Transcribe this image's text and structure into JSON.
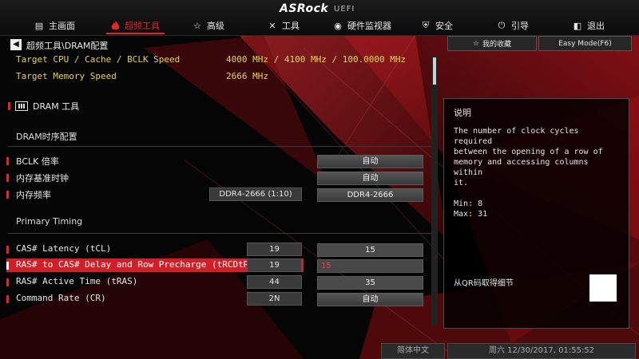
{
  "header": {
    "brand": "ASRock",
    "subtitle": "UEFI"
  },
  "tabs": [
    {
      "label": "主画面",
      "icon": "home-icon"
    },
    {
      "label": "超频工具",
      "icon": "flame-icon",
      "active": true
    },
    {
      "label": "高级",
      "icon": "star-icon"
    },
    {
      "label": "工具",
      "icon": "tools-icon"
    },
    {
      "label": "硬件监视器",
      "icon": "monitor-icon"
    },
    {
      "label": "安全",
      "icon": "shield-icon"
    },
    {
      "label": "引导",
      "icon": "power-icon"
    },
    {
      "label": "退出",
      "icon": "exit-icon"
    }
  ],
  "breadcrumb": "超频工具\\DRAM配置",
  "info": [
    {
      "label": "Target CPU / Cache / BCLK Speed",
      "value": "4000 MHz / 4100 MHz / 100.0000 MHz"
    },
    {
      "label": "Target Memory Speed",
      "value": "2666 MHz"
    }
  ],
  "dram_tool": "DRAM 工具",
  "section_dram": "DRAM时序配置",
  "section_primary": "Primary Timing",
  "rows": [
    {
      "label": "BCLK 倍率",
      "control": "自动"
    },
    {
      "label": "内存基准时钟",
      "control": "自动"
    },
    {
      "label": "内存频率",
      "current": "DDR4-2666 (1:10)",
      "control": "DDR4-2666"
    },
    {
      "label": "CAS# Latency (tCL)",
      "current": "19",
      "control": "15"
    },
    {
      "label": "RAS# to CAS# Delay and Row Precharge (tRCDtRP)",
      "current": "19",
      "control": "15"
    },
    {
      "label": "RAS# Active Time (tRAS)",
      "current": "44",
      "control": "35"
    },
    {
      "label": "Command Rate (CR)",
      "current": "2N",
      "control": "自动"
    }
  ],
  "right": {
    "favorites": "我的收藏",
    "easy_mode": "Easy Mode(F6)",
    "help_title": "说明",
    "help_text": "The number of clock cycles required\nbetween the opening of a row of\nmemory and accessing columns within\nit.\n\nMin: 8\nMax: 31",
    "qr_label": "从QR码取得细节"
  },
  "footer": {
    "language": "简体中文",
    "datetime": "周六 12/30/2017, 01:55:52"
  },
  "colors": {
    "accent": "#e0252b",
    "info_text": "#e6d54a"
  }
}
